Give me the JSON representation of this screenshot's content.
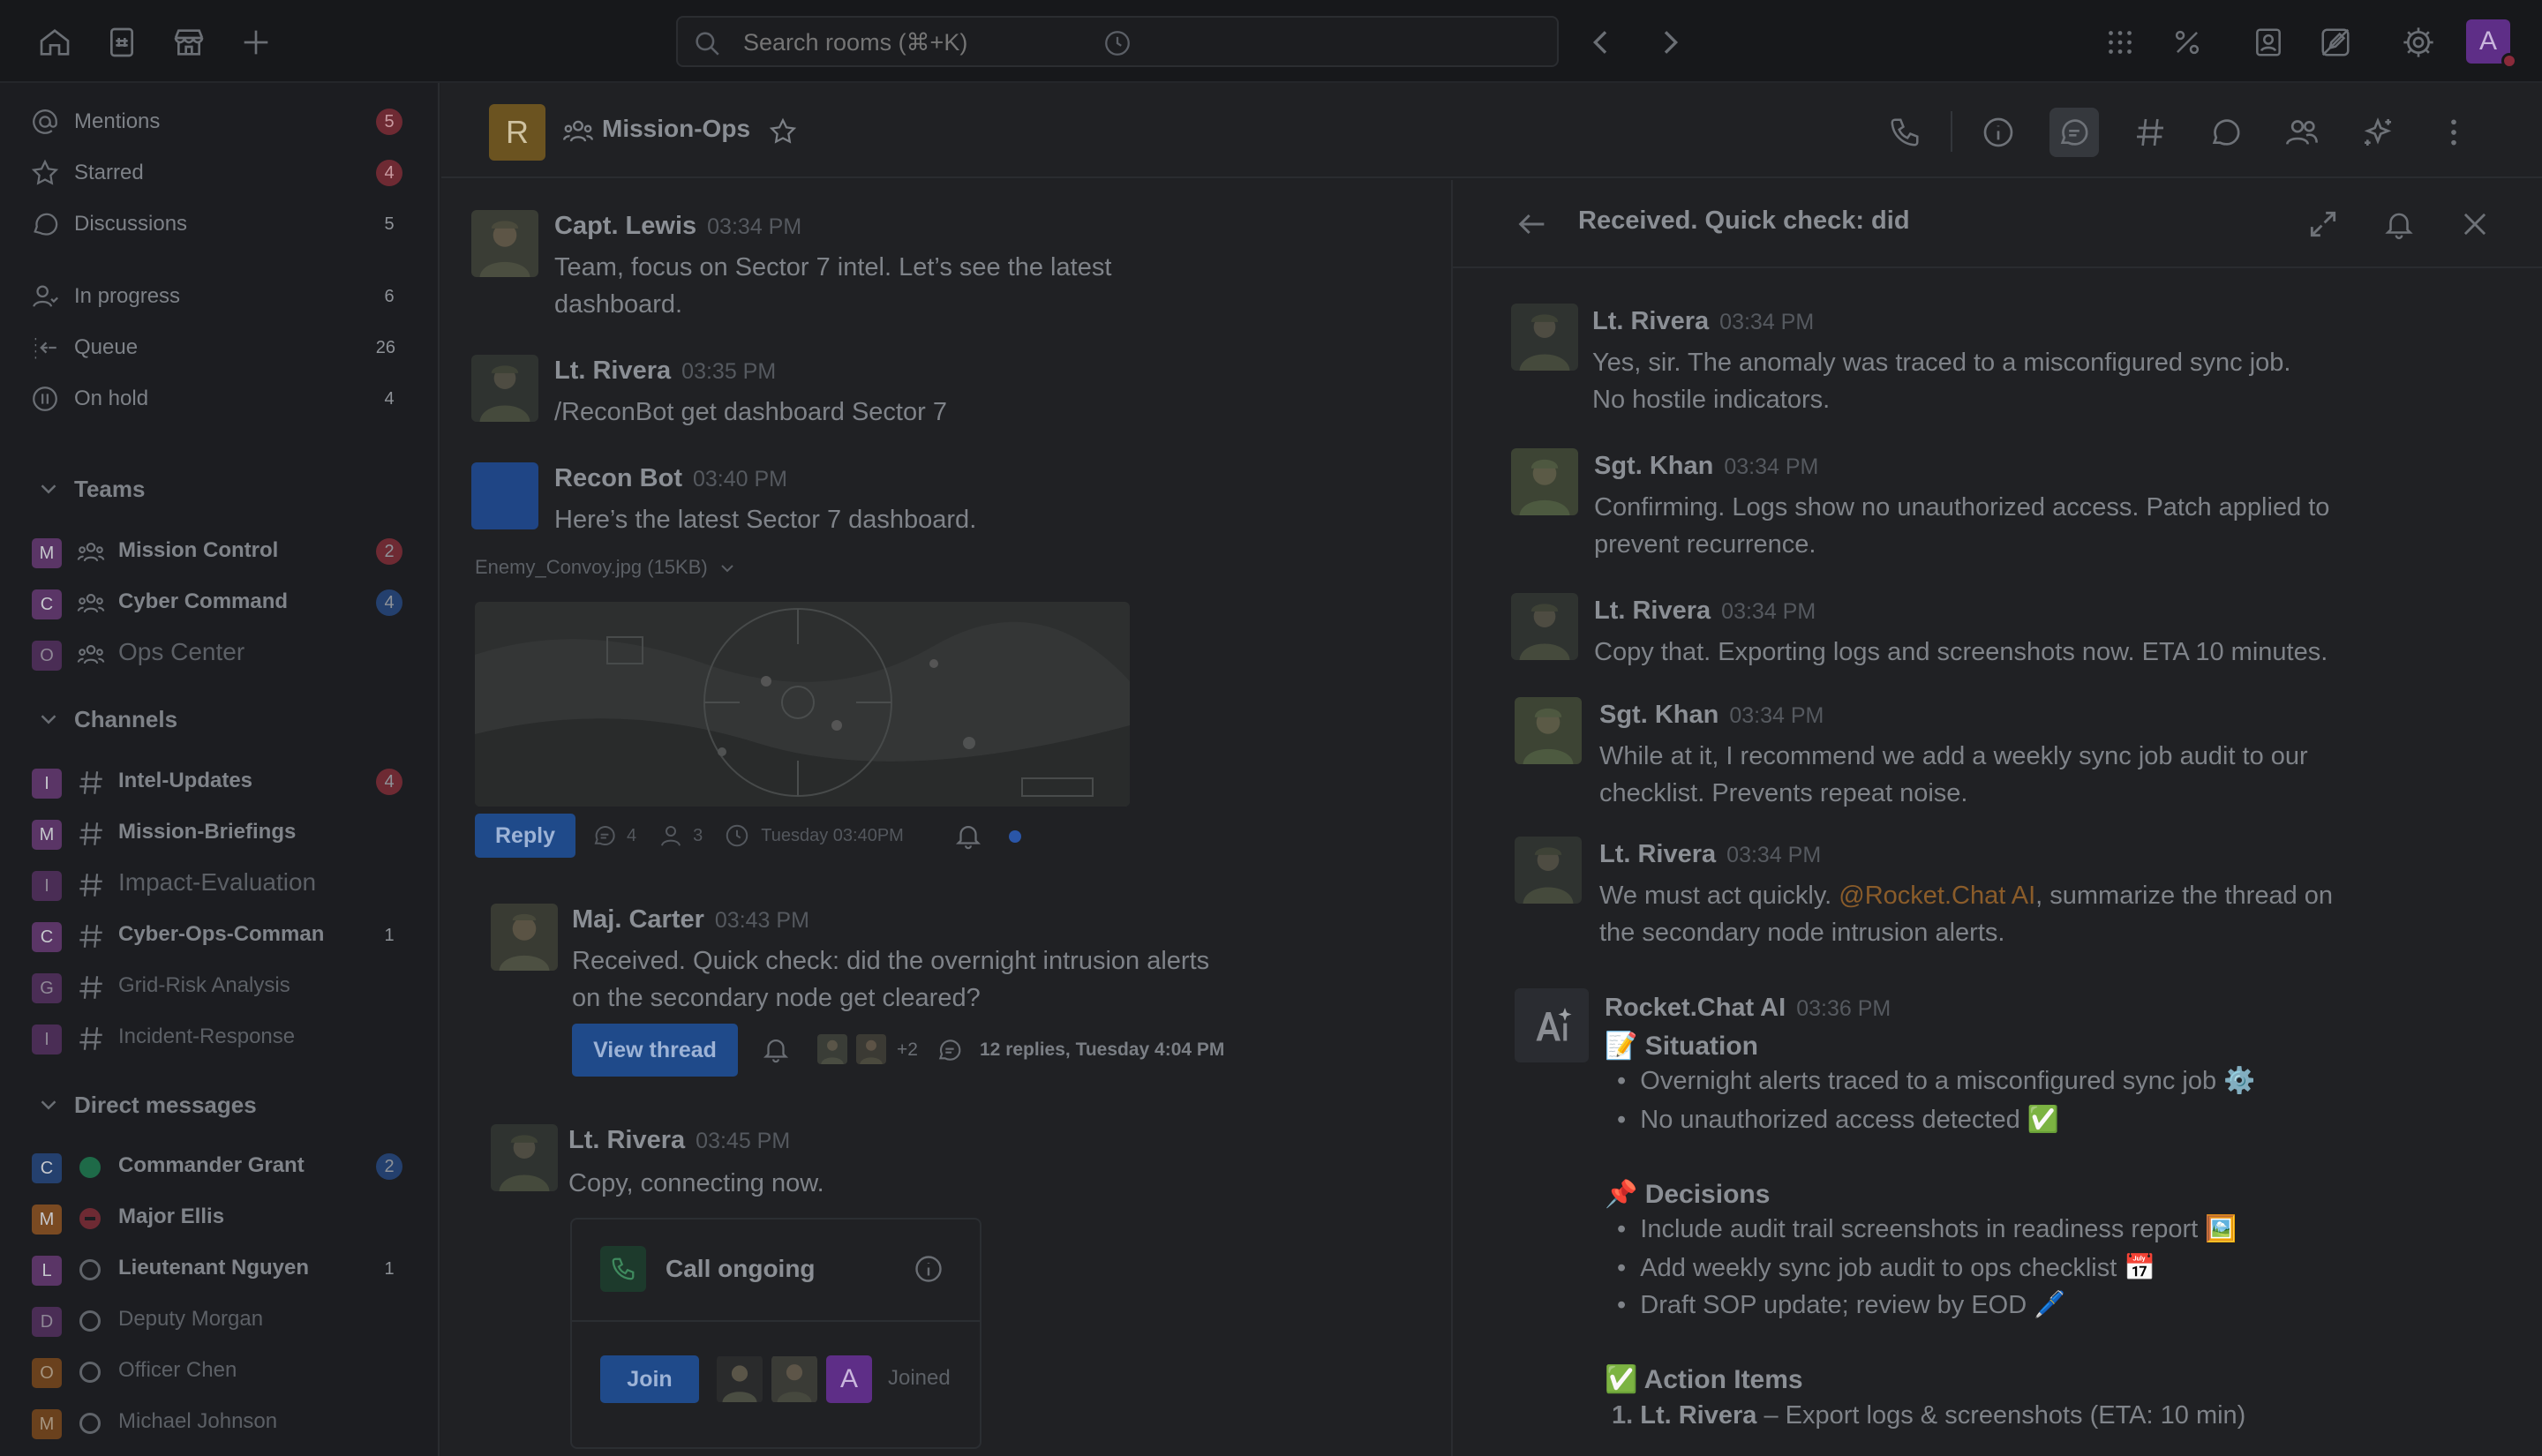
{
  "topbar": {
    "search_placeholder": "Search rooms (⌘+K)",
    "user_initial": "A",
    "icons": [
      "home-icon",
      "directory-icon",
      "marketplace-icon",
      "plus-icon",
      "history-icon",
      "back-icon",
      "forward-icon",
      "apps-icon",
      "percent-icon",
      "address-book-icon",
      "edit-off-icon",
      "settings-icon"
    ]
  },
  "sidebar": {
    "filters": [
      {
        "label": "Mentions",
        "count": "5",
        "style": "red"
      },
      {
        "label": "Starred",
        "count": "4",
        "style": "red"
      },
      {
        "label": "Discussions",
        "count": "5",
        "style": "plain"
      },
      {
        "label": "In progress",
        "count": "6",
        "style": "plain"
      },
      {
        "label": "Queue",
        "count": "26",
        "style": "plain"
      },
      {
        "label": "On hold",
        "count": "4",
        "style": "plain"
      }
    ],
    "teams_label": "Teams",
    "teams": [
      {
        "initial": "M",
        "name": "Mission Control",
        "count": "2",
        "style": "red",
        "color": "#6b3b7a"
      },
      {
        "initial": "C",
        "name": "Cyber Command",
        "count": "4",
        "style": "blue",
        "color": "#6b3b7a"
      },
      {
        "initial": "O",
        "name": "Ops Center",
        "count": "",
        "style": "",
        "color": "#6b3b7a"
      }
    ],
    "channels_label": "Channels",
    "channels": [
      {
        "initial": "I",
        "name": "Intel-Updates",
        "count": "4",
        "style": "red",
        "color": "#6b3b7a"
      },
      {
        "initial": "M",
        "name": "Mission-Briefings",
        "count": "",
        "style": "",
        "color": "#6b3b7a"
      },
      {
        "initial": "I",
        "name": "Impact-Evaluation",
        "count": "",
        "style": "",
        "color": "#6b3b7a"
      },
      {
        "initial": "C",
        "name": "Cyber-Ops-Comman",
        "count": "1",
        "style": "plain",
        "color": "#6b3b7a"
      },
      {
        "initial": "G",
        "name": "Grid-Risk Analysis",
        "count": "",
        "style": "",
        "color": "#6b3b7a"
      },
      {
        "initial": "I",
        "name": "Incident-Response",
        "count": "",
        "style": "",
        "color": "#6b3b7a"
      }
    ],
    "dm_label": "Direct messages",
    "dms": [
      {
        "initial": "C",
        "name": "Commander Grant",
        "count": "2",
        "style": "blue",
        "color": "#24406e",
        "status": "online"
      },
      {
        "initial": "M",
        "name": "Major Ellis",
        "count": "",
        "style": "",
        "color": "#7a4a22",
        "status": "busy"
      },
      {
        "initial": "L",
        "name": "Lieutenant Nguyen",
        "count": "1",
        "style": "plain",
        "color": "#6b3b7a",
        "status": "offline"
      },
      {
        "initial": "D",
        "name": "Deputy Morgan",
        "count": "",
        "style": "",
        "color": "#6b3b7a",
        "status": "offline"
      },
      {
        "initial": "O",
        "name": "Officer Chen",
        "count": "",
        "style": "",
        "color": "#7a4a22",
        "status": "offline"
      },
      {
        "initial": "M",
        "name": "Michael Johnson",
        "count": "",
        "style": "",
        "color": "#7a4a22",
        "status": "offline"
      }
    ]
  },
  "room": {
    "avatar_initial": "R",
    "title": "Mission-Ops"
  },
  "messages": {
    "m1": {
      "name": "Capt. Lewis",
      "time": "03:34 PM",
      "line1": "Team, focus on Sector 7 intel. Let’s see the latest",
      "line2": "dashboard."
    },
    "m2": {
      "name": "Lt. Rivera",
      "time": "03:35 PM",
      "line1": "/ReconBot get dashboard Sector 7"
    },
    "m3": {
      "name": "Recon Bot",
      "time": "03:40 PM",
      "line1": "Here’s the latest Sector 7 dashboard.",
      "attachment": "Enemy_Convoy.jpg (15KB)",
      "reply": "Reply",
      "replies": "4",
      "participants": "3",
      "date": "Tuesday 03:40PM"
    },
    "m4": {
      "name": "Maj. Carter",
      "time": "03:43 PM",
      "line1": "Received. Quick check: did the overnight intrusion alerts",
      "line2": "on the secondary node get cleared?",
      "view_thread": "View thread",
      "more": "+2",
      "thread_meta": "12 replies, Tuesday 4:04 PM"
    },
    "m5": {
      "name": "Lt. Rivera",
      "time": "03:45 PM",
      "line1": "Copy, connecting now.",
      "call_label": "Call ongoing",
      "join": "Join",
      "avatar_a": "A",
      "joined": "Joined"
    }
  },
  "thread": {
    "title": "Received. Quick check: did",
    "t1": {
      "name": "Lt. Rivera",
      "time": "03:34 PM",
      "line1": "Yes, sir. The anomaly was traced to a misconfigured sync job.",
      "line2": "No hostile indicators."
    },
    "t2": {
      "name": "Sgt. Khan",
      "time": "03:34 PM",
      "line1": "Confirming. Logs show no unauthorized access. Patch applied to",
      "line2": "prevent recurrence."
    },
    "t3": {
      "name": "Lt. Rivera",
      "time": "03:34 PM",
      "line1": "Copy that. Exporting logs and screenshots now. ETA 10 minutes."
    },
    "t4": {
      "name": "Sgt. Khan",
      "time": "03:34 PM",
      "line1": "While at it, I recommend we add a weekly sync job audit to our",
      "line2": "checklist. Prevents repeat noise."
    },
    "t5": {
      "name": "Lt. Rivera",
      "time": "03:34 PM",
      "line1_pre": "We must act quickly. ",
      "mention": "@Rocket.Chat AI",
      "line1_post": ", summarize the thread on",
      "line2": "the secondary node intrusion alerts."
    },
    "t6": {
      "name": "Rocket.Chat AI",
      "time": "03:36 PM",
      "situation_title": "📝 Situation",
      "situation": [
        "Overnight alerts traced to a misconfigured sync job ⚙️",
        "No unauthorized access detected ✅"
      ],
      "decisions_title": "📌 Decisions",
      "decisions": [
        "Include audit trail screenshots in readiness report 🖼️",
        "Add weekly sync job audit to ops checklist 📅",
        "Draft SOP update; review by EOD 🖊️"
      ],
      "actions_title": "✅ Action Items",
      "action1_num": "1.",
      "action1_name": "Lt. Rivera",
      "action1_text": " – Export logs & screenshots (ETA: 10 min)"
    }
  }
}
